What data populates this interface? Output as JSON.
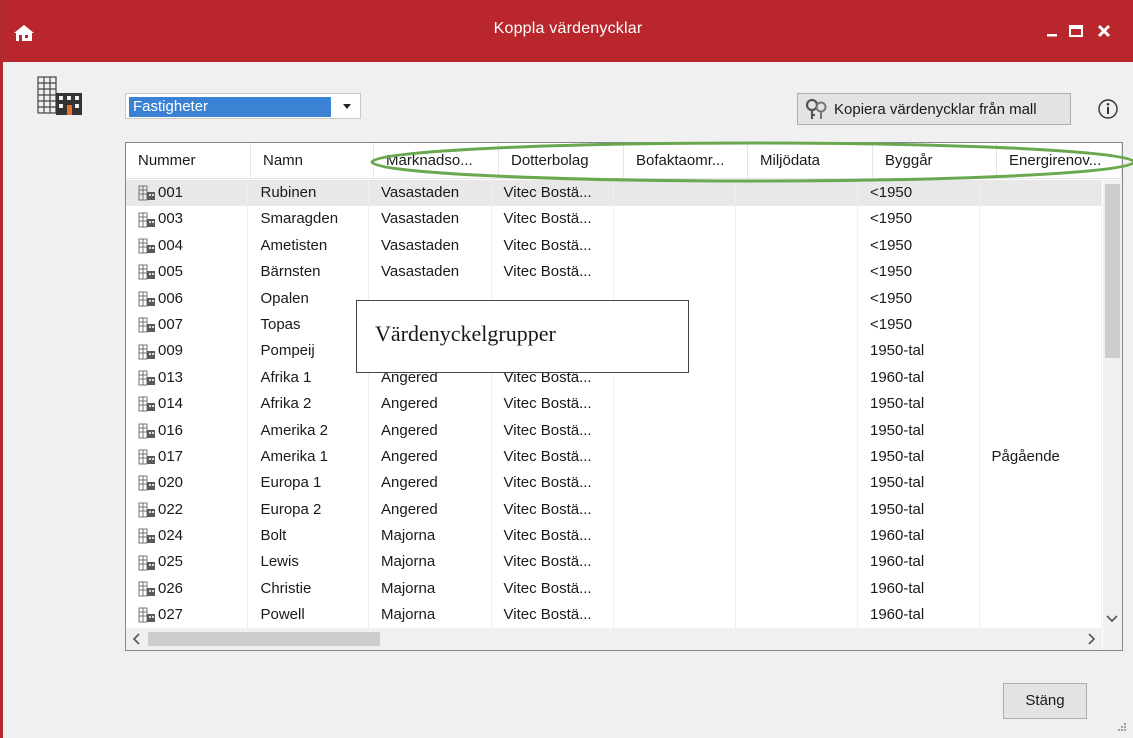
{
  "window": {
    "title": "Koppla värdenycklar",
    "accent_color": "#b9272d",
    "controls": {
      "minimize": "minimize-icon",
      "maximize": "maximize-icon",
      "close": "close-icon"
    }
  },
  "toolbar": {
    "category_select": {
      "value": "Fastigheter"
    },
    "copy_button_label": "Kopiera värdenycklar från mall",
    "info_icon": "info-icon"
  },
  "annotation": {
    "callout_text": "Värdenyckelgrupper",
    "ellipse_color": "#6aa84f"
  },
  "table": {
    "columns": [
      "Nummer",
      "Namn",
      "Marknadso...",
      "Dotterbolag",
      "Bofaktaomr...",
      "Miljödata",
      "Byggår",
      "Energirenov..."
    ],
    "rows": [
      [
        "001",
        "Rubinen",
        "Vasastaden",
        "Vitec Bostä...",
        "",
        "",
        "<1950",
        ""
      ],
      [
        "003",
        "Smaragden",
        "Vasastaden",
        "Vitec Bostä...",
        "",
        "",
        "<1950",
        ""
      ],
      [
        "004",
        "Ametisten",
        "Vasastaden",
        "Vitec Bostä...",
        "",
        "",
        "<1950",
        ""
      ],
      [
        "005",
        "Bärnsten",
        "Vasastaden",
        "Vitec Bostä...",
        "",
        "",
        "<1950",
        ""
      ],
      [
        "006",
        "Opalen",
        "",
        "",
        "",
        "",
        "<1950",
        ""
      ],
      [
        "007",
        "Topas",
        "",
        "",
        "",
        "",
        "<1950",
        ""
      ],
      [
        "009",
        "Pompeij",
        "",
        "",
        "",
        "",
        "1950-tal",
        ""
      ],
      [
        "013",
        "Afrika 1",
        "Angered",
        "Vitec Bostä...",
        "",
        "",
        "1960-tal",
        ""
      ],
      [
        "014",
        "Afrika 2",
        "Angered",
        "Vitec Bostä...",
        "",
        "",
        "1950-tal",
        ""
      ],
      [
        "016",
        "Amerika 2",
        "Angered",
        "Vitec Bostä...",
        "",
        "",
        "1950-tal",
        ""
      ],
      [
        "017",
        "Amerika 1",
        "Angered",
        "Vitec Bostä...",
        "",
        "",
        "1950-tal",
        "Pågående"
      ],
      [
        "020",
        "Europa 1",
        "Angered",
        "Vitec Bostä...",
        "",
        "",
        "1950-tal",
        ""
      ],
      [
        "022",
        "Europa 2",
        "Angered",
        "Vitec Bostä...",
        "",
        "",
        "1950-tal",
        ""
      ],
      [
        "024",
        "Bolt",
        "Majorna",
        "Vitec Bostä...",
        "",
        "",
        "1960-tal",
        ""
      ],
      [
        "025",
        "Lewis",
        "Majorna",
        "Vitec Bostä...",
        "",
        "",
        "1960-tal",
        ""
      ],
      [
        "026",
        "Christie",
        "Majorna",
        "Vitec Bostä...",
        "",
        "",
        "1960-tal",
        ""
      ],
      [
        "027",
        "Powell",
        "Majorna",
        "Vitec Bostä...",
        "",
        "",
        "1960-tal",
        ""
      ]
    ],
    "selected_row": 0
  },
  "footer": {
    "close_button_label": "Stäng"
  }
}
